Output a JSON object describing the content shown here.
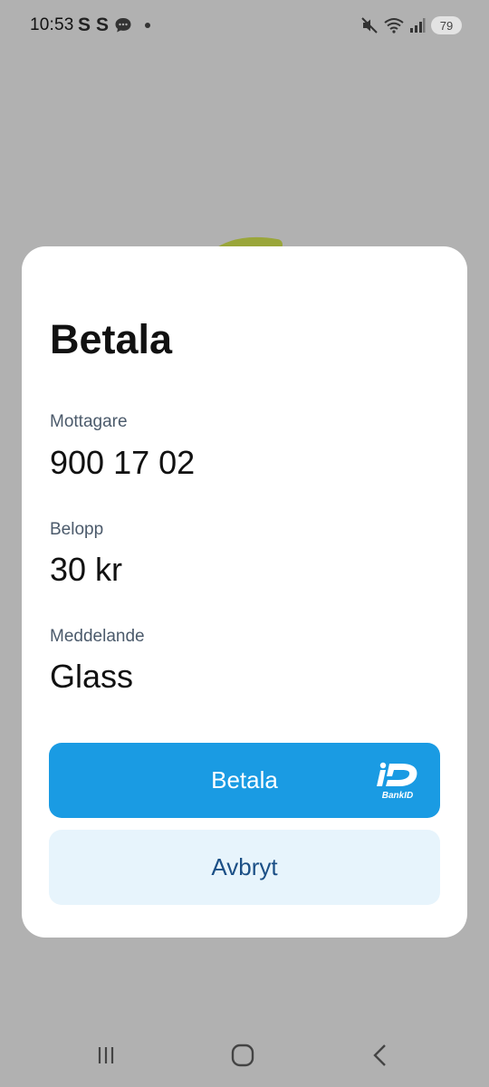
{
  "status_bar": {
    "time": "10:53",
    "left_icons": [
      "S",
      "S"
    ],
    "battery": "79"
  },
  "dialog": {
    "title": "Betala",
    "fields": [
      {
        "label": "Mottagare",
        "value": "900 17 02"
      },
      {
        "label": "Belopp",
        "value": "30 kr"
      },
      {
        "label": "Meddelande",
        "value": "Glass"
      }
    ],
    "pay_button": {
      "label": "Betala",
      "badge": "BankID"
    },
    "cancel_button": {
      "label": "Avbryt"
    }
  },
  "colors": {
    "pay_button": "#1a9be3",
    "cancel_button_bg": "#e7f4fc",
    "cancel_button_text": "#1b4f86",
    "backdrop": "#b1b1b1"
  }
}
